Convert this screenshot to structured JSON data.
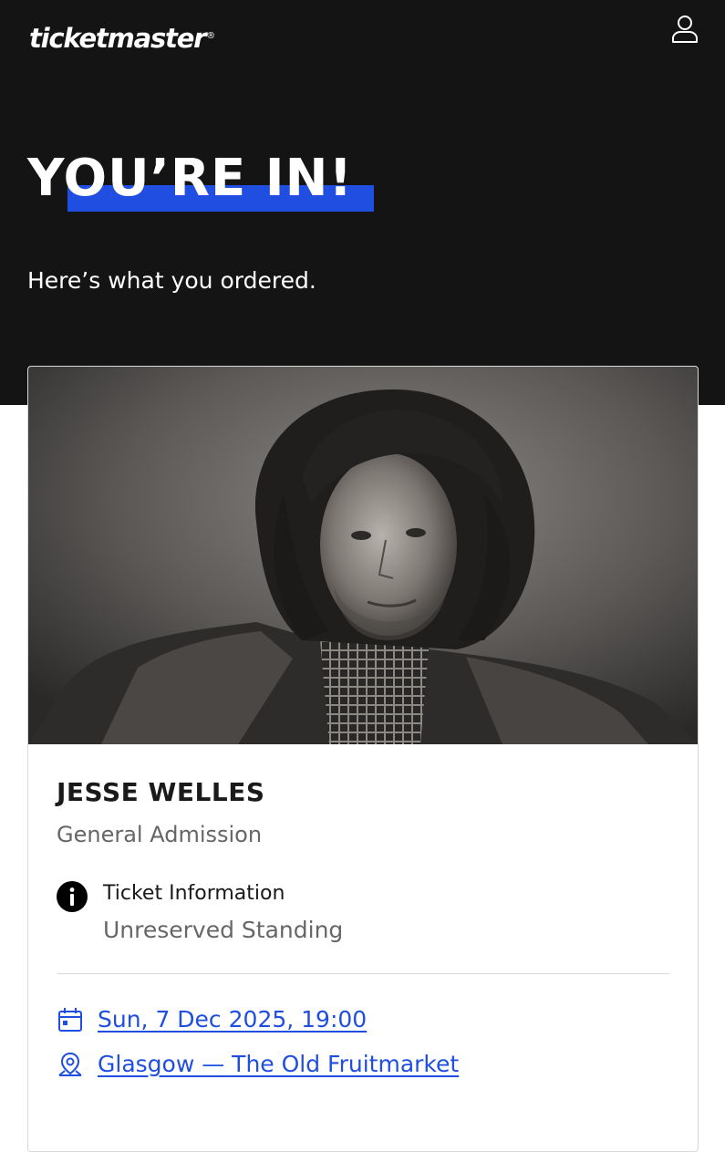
{
  "header": {
    "logo_text": "ticketmaster",
    "logo_mark": "®",
    "account_icon": "user-icon"
  },
  "hero": {
    "headline": "YOU’RE IN!",
    "subhead": "Here’s what you ordered.",
    "accent_color": "#1f4ee0",
    "background_color": "#141414"
  },
  "order": {
    "event_name": "JESSE WELLES",
    "ticket_type": "General Admission",
    "ticket_info": {
      "icon": "info-icon",
      "label": "Ticket Information",
      "value": "Unreserved Standing"
    },
    "date": {
      "icon": "calendar-icon",
      "text": "Sun, 7 Dec 2025, 19:00"
    },
    "venue": {
      "icon": "map-pin-icon",
      "text": "Glasgow — The Old Fruitmarket"
    },
    "link_color": "#1f4ee0"
  }
}
